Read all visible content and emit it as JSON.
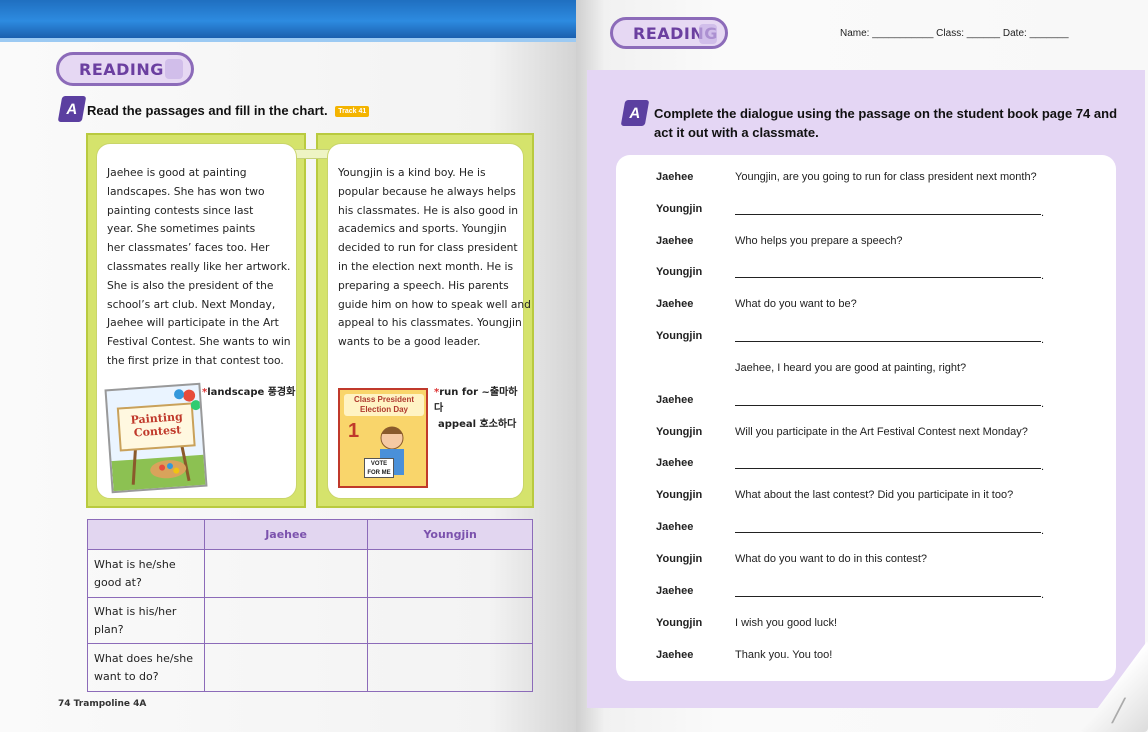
{
  "left_page": {
    "badge": "READING",
    "instruction": {
      "letter": "A",
      "text": "Read the passages and fill in the chart.",
      "track": "Track 41"
    },
    "passage_jaehee": [
      "Jaehee is good at painting",
      "landscapes. She has won two",
      "painting contests since last",
      "year. She sometimes paints",
      "her classmates’ faces too. Her",
      "classmates really like her artwork.",
      "She is also the president of the",
      "school’s art club. Next Monday,",
      "Jaehee will participate in the Art",
      "Festival Contest. She wants to win",
      "the first prize in that contest too."
    ],
    "gloss_jaehee": "landscape 풍경화",
    "passage_youngjin": [
      "Youngjin is a kind boy. He is",
      "popular because he always helps",
      "his classmates. He is also good in",
      "academics and sports. Youngjin",
      "decided to run for class president",
      "in the election next month. He is",
      "preparing a speech. His parents",
      "guide him on how to speak well and",
      "appeal to his classmates. Youngjin",
      "wants to be a good leader."
    ],
    "gloss_youngjin": [
      "run for ~출마하다",
      "appeal 호소하다"
    ],
    "pic_painting": "Painting Contest",
    "pic_election": {
      "title": "Class President Election Day",
      "number": "1",
      "sign": "VOTE FOR ME"
    },
    "chart": {
      "headers": [
        "",
        "Jaehee",
        "Youngjin"
      ],
      "rows": [
        "What is he/she good at?",
        "What is his/her plan?",
        "What does he/she want to do?"
      ]
    },
    "footer": "74  Trampoline 4A"
  },
  "right_page": {
    "badge": "READING",
    "name_line": "Name: ___________ Class: ______ Date: _______",
    "instruction": {
      "letter": "A",
      "text": "Complete the dialogue using the passage on the student book page 74 and act it out with a classmate."
    },
    "dialogue": [
      {
        "speaker": "Jaehee",
        "text": "Youngjin, are you going to run for class president next month?"
      },
      {
        "speaker": "Youngjin",
        "text": "",
        "blank": true
      },
      {
        "speaker": "Jaehee",
        "text": "Who helps you prepare a speech?"
      },
      {
        "speaker": "Youngjin",
        "text": "",
        "blank": true
      },
      {
        "speaker": "Jaehee",
        "text": "What do you want to be?"
      },
      {
        "speaker": "Youngjin",
        "text": "",
        "blank": true
      },
      {
        "speaker": "",
        "text": "Jaehee,  I heard you are good at painting, right?"
      },
      {
        "speaker": "Jaehee",
        "text": "",
        "blank": true
      },
      {
        "speaker": "Youngjin",
        "text": "Will you participate in the Art Festival Contest next Monday?"
      },
      {
        "speaker": "Jaehee",
        "text": "",
        "blank": true
      },
      {
        "speaker": "Youngjin",
        "text": "What about the last contest? Did you participate in it too?"
      },
      {
        "speaker": "Jaehee",
        "text": "",
        "blank": true
      },
      {
        "speaker": "Youngjin",
        "text": "What do you want to do in this contest?"
      },
      {
        "speaker": "Jaehee",
        "text": "",
        "blank": true
      },
      {
        "speaker": "Youngjin",
        "text": "I wish you good luck!"
      },
      {
        "speaker": "Jaehee",
        "text": "Thank you. You too!"
      }
    ]
  },
  "colors": {
    "accent_purple": "#8c6bb9",
    "lime": "#d5e36c",
    "blue_bar": "#2d8be0"
  }
}
